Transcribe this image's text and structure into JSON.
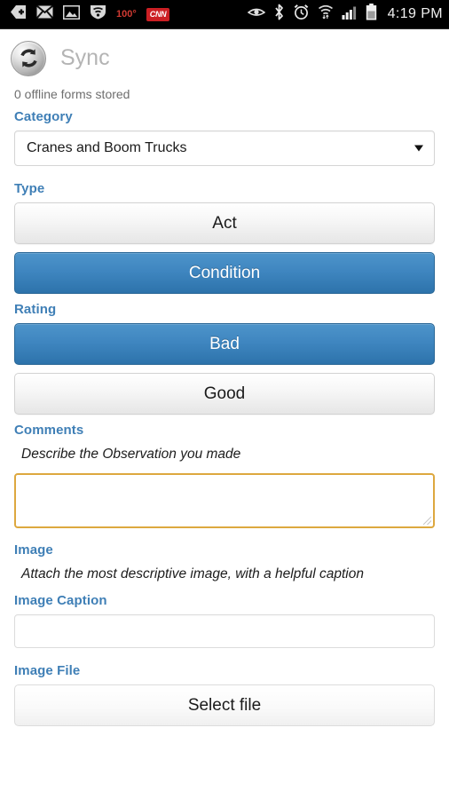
{
  "status_bar": {
    "left_icons": [
      {
        "name": "tag-plus-icon",
        "label": "add-tag"
      },
      {
        "name": "envelope-icon",
        "label": "mail"
      },
      {
        "name": "picture-icon",
        "label": "screenshot"
      },
      {
        "name": "wifi-shield-icon",
        "label": "wifi-shield"
      }
    ],
    "temperature": "100°",
    "news_badge": "CNN",
    "right_icons": [
      {
        "name": "eye-icon",
        "label": "smart-stay"
      },
      {
        "name": "bluetooth-icon",
        "label": "bluetooth"
      },
      {
        "name": "alarm-clock-icon",
        "label": "alarm"
      },
      {
        "name": "wifi-icon",
        "label": "wifi"
      },
      {
        "name": "signal-bars-icon",
        "label": "cellular-signal"
      },
      {
        "name": "battery-icon",
        "label": "battery"
      }
    ],
    "time": "4:19 PM"
  },
  "header": {
    "title": "Sync",
    "icon": "sync-icon"
  },
  "form": {
    "offline_status": "0 offline forms stored",
    "category": {
      "label": "Category",
      "selected": "Cranes and Boom Trucks",
      "caret": "chevron-down-icon"
    },
    "type": {
      "label": "Type",
      "options": [
        {
          "text": "Act",
          "selected": false
        },
        {
          "text": "Condition",
          "selected": true
        }
      ]
    },
    "rating": {
      "label": "Rating",
      "options": [
        {
          "text": "Bad",
          "selected": true
        },
        {
          "text": "Good",
          "selected": false
        }
      ]
    },
    "comments": {
      "label": "Comments",
      "help": "Describe the Observation you made",
      "value": ""
    },
    "image": {
      "label": "Image",
      "help": "Attach the most descriptive image, with a helpful caption"
    },
    "image_caption": {
      "label": "Image Caption",
      "value": ""
    },
    "image_file": {
      "label": "Image File",
      "button_text": "Select file"
    }
  },
  "colors": {
    "label_blue": "#3f7fb6",
    "button_active": "#3f86c0",
    "textarea_border": "#dda83f",
    "news_badge_red": "#cc1f24",
    "temperature_red": "#d03a32"
  }
}
